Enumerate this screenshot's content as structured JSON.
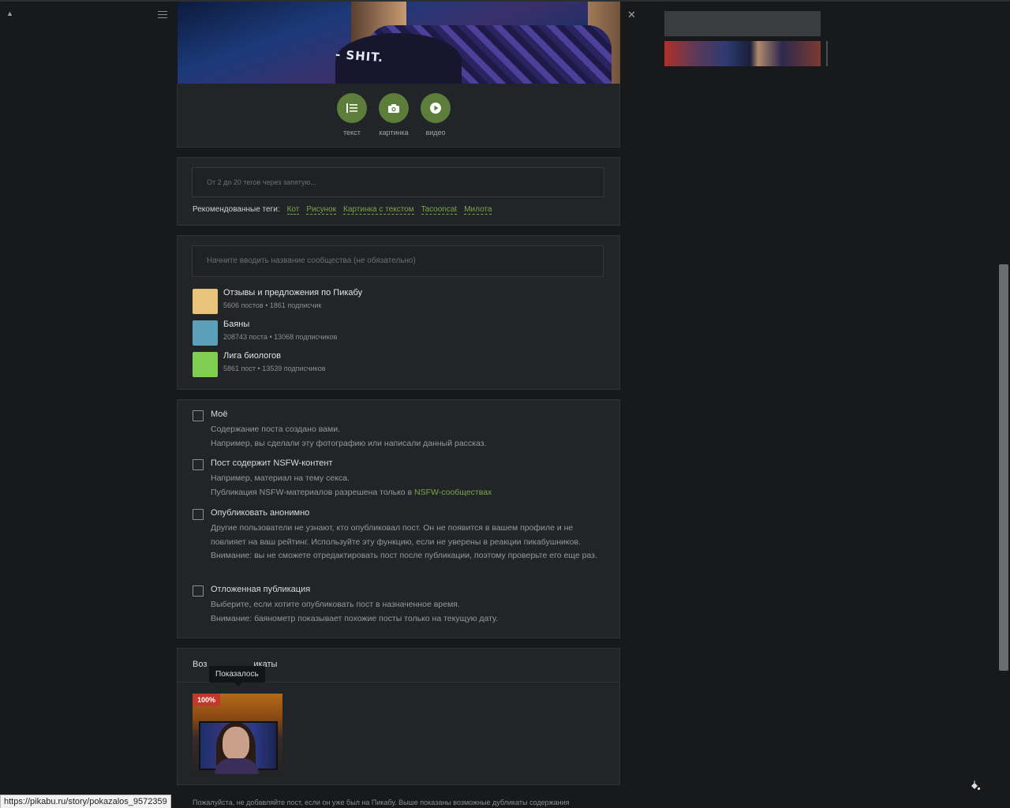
{
  "post_types": [
    {
      "label": "текст",
      "icon": "text-icon"
    },
    {
      "label": "картинка",
      "icon": "camera-icon"
    },
    {
      "label": "видео",
      "icon": "play-icon"
    }
  ],
  "hero": {
    "shirt_text": "- SHIT."
  },
  "tags": {
    "placeholder": "От 2 до 20 тегов через запятую...",
    "recommended_label": "Рекомендованные теги:",
    "recommended": [
      "Кот",
      "Рисунок",
      "Картинка с текстом",
      "Tacooncat",
      "Милота"
    ]
  },
  "community": {
    "placeholder": "Начните вводить название сообщества (не обязательно)",
    "items": [
      {
        "name": "Отзывы и предложения по Пикабу",
        "posts": "5606 постов",
        "subscribers": "1861 подписчик",
        "color": "#e8c47a"
      },
      {
        "name": "Баяны",
        "posts": "208743 поста",
        "subscribers": "13068 подписчиков",
        "color": "#5aa0b8"
      },
      {
        "name": "Лига биологов",
        "posts": "5861 пост",
        "subscribers": "13539 подписчиков",
        "color": "#7fce52"
      }
    ]
  },
  "options": [
    {
      "title": "Моё",
      "desc_lines": [
        "Содержание поста создано вами.",
        "Например, вы сделали эту фотографию или написали данный рассказ."
      ]
    },
    {
      "title": "Пост содержит NSFW-контент",
      "desc_lines": [
        "Например, материал на тему секса."
      ],
      "desc_prefix": "Публикация NSFW-материалов разрешена только в ",
      "desc_link": "NSFW-сообществах"
    },
    {
      "title": "Опубликовать анонимно",
      "desc": "Другие пользователи не узнают, кто опубликовал пост. Он не появится в вашем профиле и не повлияет на ваш рейтинг. Используйте эту функцию, если не уверены в реакции пикабушников. Внимание: вы не сможете отредактировать пост после публикации, поэтому проверьте его еще раз."
    },
    {
      "title": "Отложенная публикация",
      "desc_lines": [
        "Выберите, если хотите опубликовать пост в назначенное время.",
        "Внимание: баянометр показывает похожие посты только на текущую дату."
      ]
    }
  ],
  "dupes": {
    "header_visible_start": "Воз",
    "header_visible_end": "икаты",
    "tooltip": "Показалось",
    "badge": "100%",
    "notice": "Пожалуйста, не добавляйте пост, если он уже был на Пикабу. Выше показаны возможные дубликаты содержания"
  },
  "status_url": "https://pikabu.ru/story/pokazalos_9572359",
  "colors": {
    "accent": "#7ea34a",
    "button_green": "#5d7d3a",
    "badge_red": "#c4382b",
    "bg": "#17191a",
    "panel": "#222527"
  }
}
